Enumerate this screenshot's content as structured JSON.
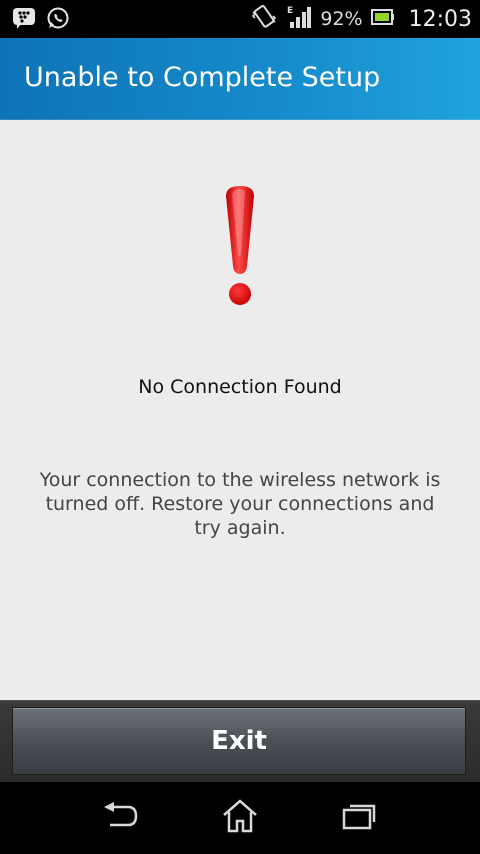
{
  "status_bar": {
    "battery_percent": "92%",
    "time": "12:03",
    "icons": [
      "blackberry-messenger-icon",
      "whatsapp-icon",
      "vibrate-icon",
      "signal-edge-icon",
      "battery-icon"
    ]
  },
  "title_bar": {
    "title": "Unable to Complete Setup",
    "color": "#168ccc"
  },
  "content": {
    "icon": "exclamation-icon",
    "icon_color": "#d40000",
    "heading": "No Connection Found",
    "message": "Your connection to the wireless network is turned off. Restore your connections and try again."
  },
  "actions": {
    "exit_label": "Exit"
  },
  "nav_bar": {
    "icons": [
      "back-icon",
      "home-icon",
      "recent-apps-icon"
    ]
  }
}
